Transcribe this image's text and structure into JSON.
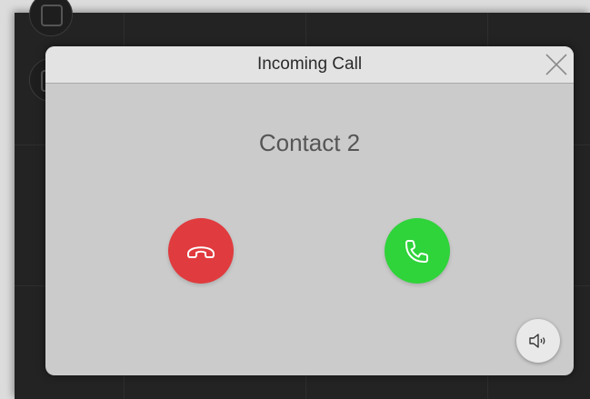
{
  "dialog": {
    "title": "Incoming Call",
    "contact_name": "Contact 2"
  },
  "icons": {
    "close": "close-icon",
    "decline": "phone-hangup-icon",
    "answer": "phone-icon",
    "speaker": "speaker-icon"
  },
  "colors": {
    "decline": "#e03b3e",
    "answer": "#2fd33a",
    "dialog_bg": "#cbcbcb",
    "header_bg": "#e3e3e3",
    "app_bg": "#232323"
  }
}
